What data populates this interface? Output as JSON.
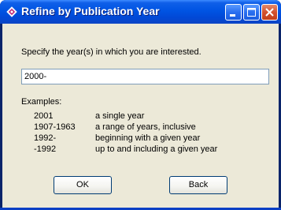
{
  "window": {
    "title": "Refine by Publication Year",
    "controls": [
      "minimize-icon",
      "maximize-icon",
      "close-icon"
    ]
  },
  "dialog": {
    "prompt": "Specify the year(s) in which you are interested.",
    "input_value": "2000-",
    "examples_label": "Examples:",
    "examples": [
      {
        "year": "2001",
        "desc": "a single year"
      },
      {
        "year": "1907-1963",
        "desc": "a range of years, inclusive"
      },
      {
        "year": "1992-",
        "desc": "beginning with a given year"
      },
      {
        "year": "-1992",
        "desc": "up to and including a given year"
      }
    ],
    "ok_label": "OK",
    "back_label": "Back"
  },
  "colors": {
    "titlebar": "#0054e3",
    "client": "#ece9d8",
    "close_button": "#d3512e"
  }
}
